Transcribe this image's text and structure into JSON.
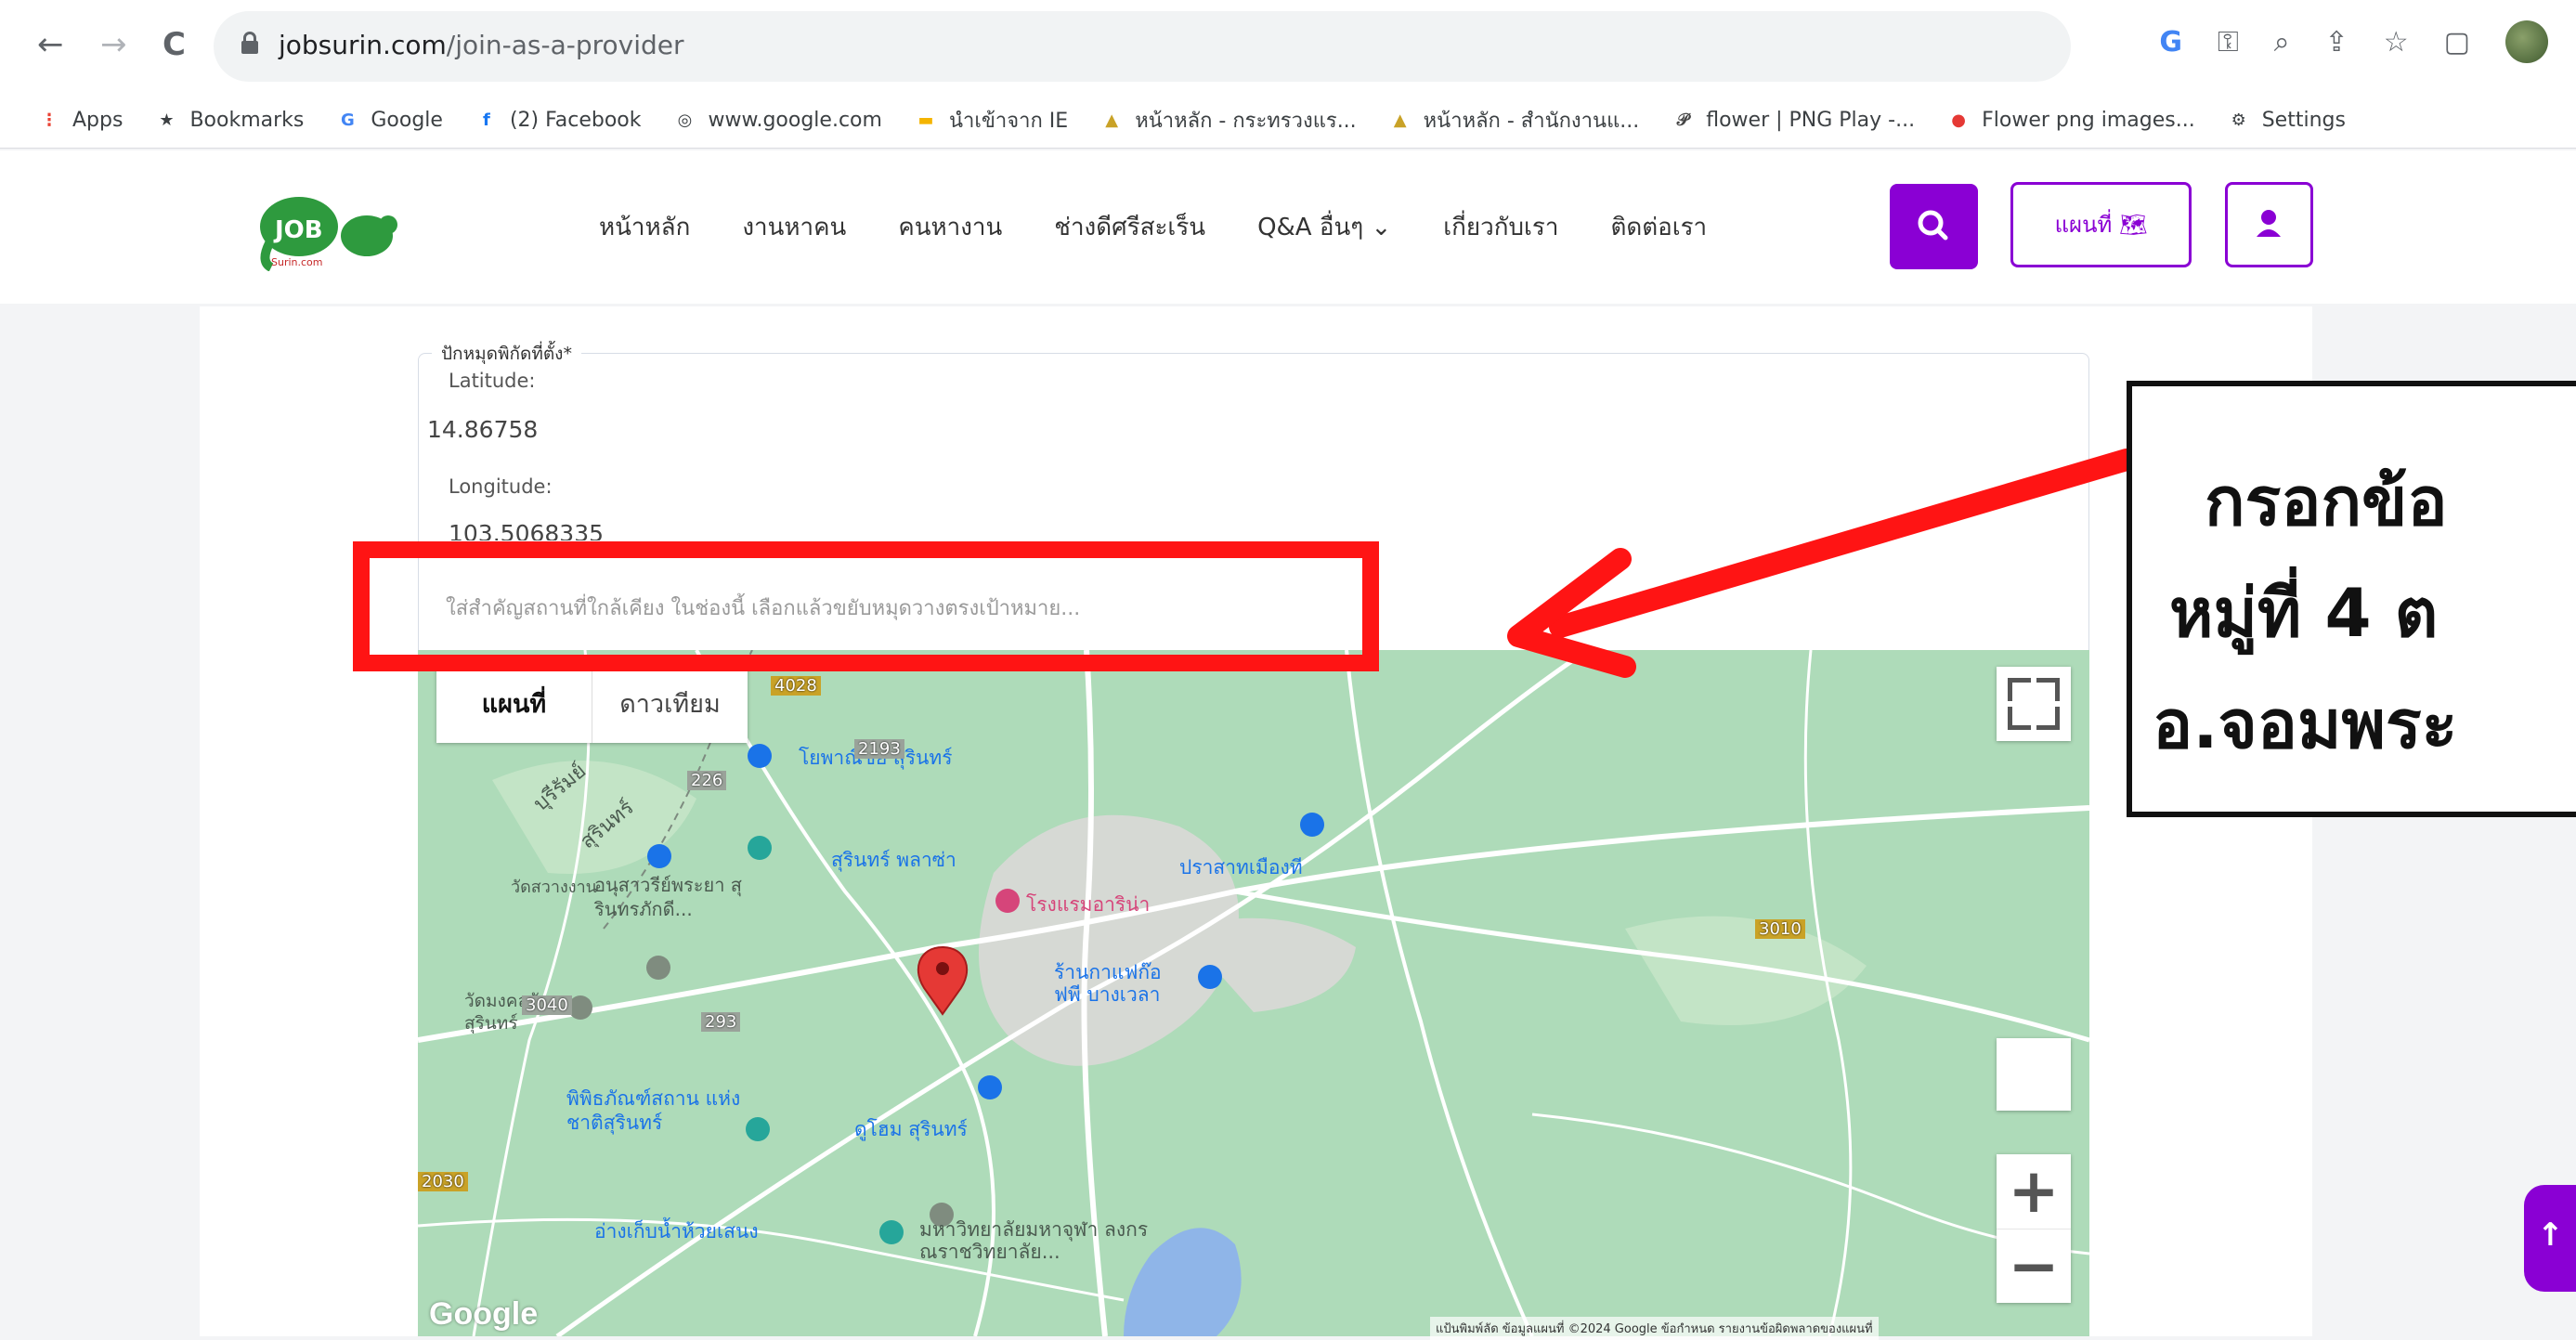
{
  "browser": {
    "nav": {
      "back": "←",
      "forward": "→",
      "reload": "C"
    },
    "url_domain": "jobsurin.com",
    "url_path": "/join-as-a-provider",
    "toolbar_icons": [
      "G",
      "key",
      "zoom",
      "share",
      "star",
      "sidebar"
    ]
  },
  "bookmarks": [
    {
      "label": "Apps",
      "icon": "apps-grid-icon",
      "color": "#ea4335"
    },
    {
      "label": "Bookmarks",
      "icon": "star-icon",
      "color": "#3c4043"
    },
    {
      "label": "Google",
      "icon": "google-icon",
      "color": "#4285f4"
    },
    {
      "label": "(2) Facebook",
      "icon": "facebook-icon",
      "color": "#1877f2"
    },
    {
      "label": "www.google.com",
      "icon": "globe-icon",
      "color": "#3c4043"
    },
    {
      "label": "นำเข้าจาก IE",
      "icon": "folder-icon",
      "color": "#f4b400"
    },
    {
      "label": "หน้าหลัก - กระทรวงแร...",
      "icon": "site-icon",
      "color": "#c9a227"
    },
    {
      "label": "หน้าหลัก - สำนักงานแ...",
      "icon": "site-icon",
      "color": "#c9a227"
    },
    {
      "label": "flower | PNG Play -...",
      "icon": "pinterest-icon",
      "color": "#444"
    },
    {
      "label": "Flower png images...",
      "icon": "drop-icon",
      "color": "#e53935"
    },
    {
      "label": "Settings",
      "icon": "gear-icon",
      "color": "#3c4043"
    }
  ],
  "site": {
    "logo_text": "JOB",
    "logo_sub": "Surin.com",
    "nav": [
      "หน้าหลัก",
      "งานหาคน",
      "คนหางาน",
      "ช่างดีศรีสะเร็น",
      "Q&A อื่นๆ ⌄",
      "เกี่ยวกับเรา",
      "ติดต่อเรา"
    ],
    "map_button": "แผนที่ 🗺"
  },
  "form": {
    "legend": "ปักหมุดพิกัดที่ตั้ง*",
    "latitude_label": "Latitude:",
    "latitude_value": "14.86758",
    "longitude_label": "Longitude:",
    "longitude_value": "103.5068335",
    "search_placeholder": "ใส่สำคัญสถานที่ใกล้เคียง ในช่องนี้ เลือกแล้วขยับหมุดวางตรงเป้าหมาย..."
  },
  "map": {
    "type_map": "แผนที่",
    "type_satellite": "ดาวเทียม",
    "google": "Google",
    "attribution": "แป้นพิมพ์ลัด   ข้อมูลแผนที่ ©2024 Google   ข้อกำหนด   รายงานข้อผิดพลาดของแผนที่",
    "places": {
      "p1": "โยพาณิชย์ สุรินทร์",
      "p2": "สุรินทร์ พลาซ่า",
      "p3": "อนุสาวรีย์พระยา สุรินทรภักดี...",
      "p4": "วัดสวางงาน",
      "p5": "วัดมงคลวัณ สุรินทร์",
      "p6": "พิพิธภัณฑ์สถาน แห่งชาติสุรินทร์",
      "p7": "ดูโฮม สุรินทร์",
      "p8": "โรงแรมอาริน่า",
      "p9": "ปราสาทเมืองที",
      "p10": "ร้านกาแฟก๊อ ฟพี บางเวลา",
      "p11": "อ่างเก็บน้ำห้วยเสนง",
      "p12": "มหาวิทยาลัยมหาจุฬา ลงกรณราชวิทยาลัย...",
      "p13": "บุรีรัมย์",
      "p14": "สุรินทร์",
      "r1": "226",
      "r2": "2193",
      "r3": "3040",
      "r4": "4028",
      "r5": "3010",
      "r6": "2030",
      "r7": "293"
    }
  },
  "annotation": {
    "line1": "กรอกข้อ",
    "line2": "หมู่ที่ 4 ต",
    "line3": "อ.จอมพระ"
  },
  "colors": {
    "brand": "#8a00d4",
    "highlight": "#ff1414",
    "map_bg": "#aedbb9"
  }
}
